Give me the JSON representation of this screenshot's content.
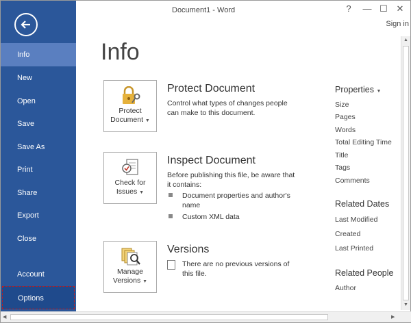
{
  "window": {
    "title": "Document1 - Word",
    "help_label": "?",
    "minimize_label": "—",
    "restore_label": "☐",
    "close_label": "✕",
    "sign_in": "Sign in"
  },
  "sidebar": {
    "back_icon": "back-arrow-icon",
    "items": [
      {
        "label": "Info",
        "active": true
      },
      {
        "label": "New"
      },
      {
        "label": "Open"
      },
      {
        "label": "Save"
      },
      {
        "label": "Save As"
      },
      {
        "label": "Print"
      },
      {
        "label": "Share"
      },
      {
        "label": "Export"
      },
      {
        "label": "Close"
      },
      {
        "label": "Account"
      },
      {
        "label": "Options",
        "highlighted": true
      }
    ],
    "colors": {
      "background": "#2b579a",
      "active": "#5a7fc0",
      "highlight_border": "#c61a1a"
    }
  },
  "main": {
    "title": "Info",
    "protect": {
      "tile_label_1": "Protect",
      "tile_label_2": "Document",
      "icon": "lock-key-icon",
      "heading": "Protect Document",
      "description": "Control what types of changes people can make to this document."
    },
    "inspect": {
      "tile_label_1": "Check for",
      "tile_label_2": "Issues",
      "icon": "check-document-icon",
      "heading": "Inspect Document",
      "description": "Before publishing this file, be aware that it contains:",
      "bullets": [
        "Document properties and author's name",
        "Custom XML data"
      ]
    },
    "versions": {
      "tile_label_1": "Manage",
      "tile_label_2": "Versions",
      "icon": "manage-versions-icon",
      "heading": "Versions",
      "description": "There are no previous versions of this file."
    }
  },
  "properties": {
    "heading": "Properties",
    "items": [
      "Size",
      "Pages",
      "Words",
      "Total Editing Time",
      "Title",
      "Tags",
      "Comments"
    ],
    "dates_heading": "Related Dates",
    "dates": [
      "Last Modified",
      "Created",
      "Last Printed"
    ],
    "people_heading": "Related People",
    "people": [
      "Author"
    ]
  }
}
